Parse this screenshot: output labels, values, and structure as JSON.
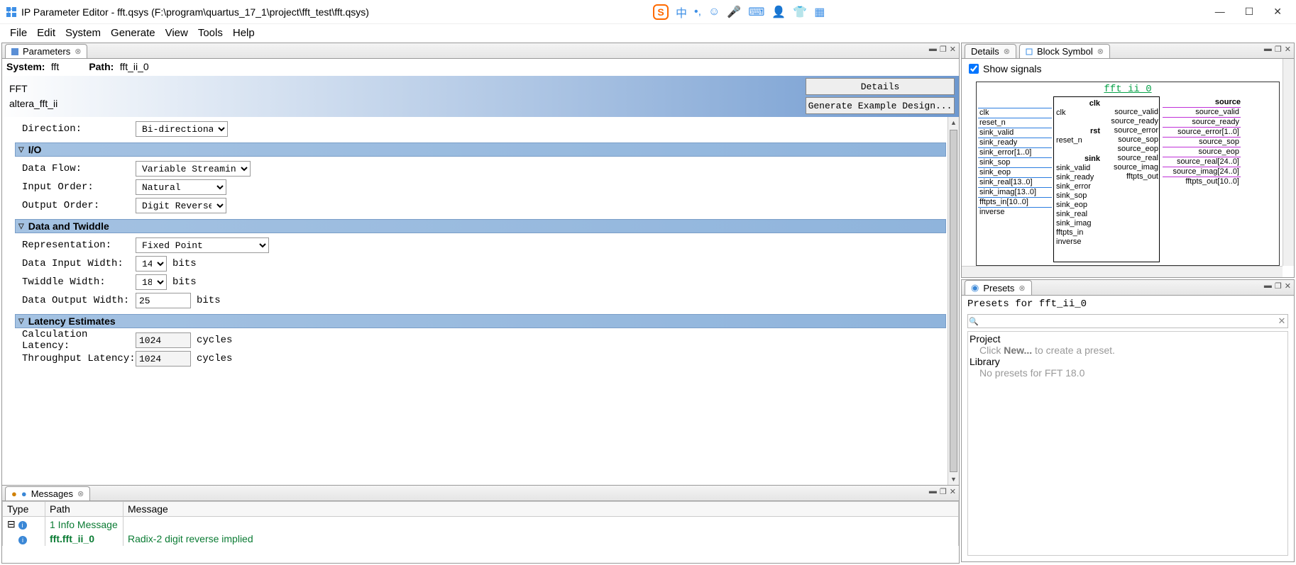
{
  "window": {
    "title": "IP Parameter Editor - fft.qsys (F:\\program\\quartus_17_1\\project\\fft_test\\fft.qsys)"
  },
  "menu": {
    "items": [
      "File",
      "Edit",
      "System",
      "Generate",
      "View",
      "Tools",
      "Help"
    ]
  },
  "tabs": {
    "parameters": "Parameters",
    "details": "Details",
    "blocksymbol": "Block Symbol",
    "messages": "Messages",
    "presets": "Presets"
  },
  "syspath": {
    "system_label": "System:",
    "system": "fft",
    "path_label": "Path:",
    "path": "fft_ii_0"
  },
  "ipheader": {
    "name": "FFT",
    "core": "altera_fft_ii",
    "details_btn": "Details",
    "gen_btn": "Generate Example Design..."
  },
  "params": {
    "direction_label": "Direction:",
    "direction": "Bi-directional",
    "section_io": "I/O",
    "dataflow_label": "Data Flow:",
    "dataflow": "Variable Streaming",
    "inputorder_label": "Input Order:",
    "inputorder": "Natural",
    "outputorder_label": "Output Order:",
    "outputorder": "Digit Reverse",
    "section_dt": "Data and Twiddle",
    "repr_label": "Representation:",
    "repr": "Fixed Point",
    "diw_label": "Data Input Width:",
    "diw": "14",
    "tw_label": "Twiddle Width:",
    "tw": "18",
    "dow_label": "Data Output Width:",
    "dow": "25",
    "bits": "bits",
    "section_lat": "Latency Estimates",
    "calc_label": "Calculation Latency:",
    "calc": "1024",
    "thr_label": "Throughput Latency:",
    "thr": "1024",
    "cycles": "cycles"
  },
  "messages": {
    "cols": {
      "type": "Type",
      "path": "Path",
      "message": "Message"
    },
    "rows": [
      {
        "type": "info",
        "path": "1 Info Message",
        "message": ""
      },
      {
        "type": "info",
        "path": "fft.fft_ii_0",
        "message": "Radix-2 digit reverse implied"
      }
    ]
  },
  "blocksymbol": {
    "show_signals": "Show signals",
    "title": "fft_ii_0",
    "left_ext": [
      "clk",
      "",
      "reset_n",
      "",
      "sink_valid",
      "sink_ready",
      "sink_error[1..0]",
      "sink_sop",
      "sink_eop",
      "sink_real[13..0]",
      "sink_imag[13..0]",
      "fftpts_in[10..0]",
      "inverse"
    ],
    "left_hdr": [
      "clk",
      "rst",
      "sink"
    ],
    "left_in": [
      "clk",
      "",
      "reset_n",
      "",
      "sink_valid",
      "sink_ready",
      "sink_error",
      "sink_sop",
      "sink_eop",
      "sink_real",
      "sink_imag",
      "fftpts_in",
      "inverse"
    ],
    "right_in": [
      "source_valid",
      "source_ready",
      "source_error",
      "source_sop",
      "source_eop",
      "source_real",
      "source_imag",
      "fftpts_out"
    ],
    "right_hdr": "source",
    "right_ext": [
      "source_valid",
      "source_ready",
      "source_error[1..0]",
      "source_sop",
      "source_eop",
      "source_real[24..0]",
      "source_imag[24..0]",
      "fftpts_out[10..0]"
    ]
  },
  "presets": {
    "header": "Presets for fft_ii_0",
    "project": "Project",
    "project_hint_pre": "Click ",
    "project_hint_bold": "New...",
    "project_hint_post": " to create a preset.",
    "library": "Library",
    "library_hint": "No presets for FFT 18.0"
  }
}
